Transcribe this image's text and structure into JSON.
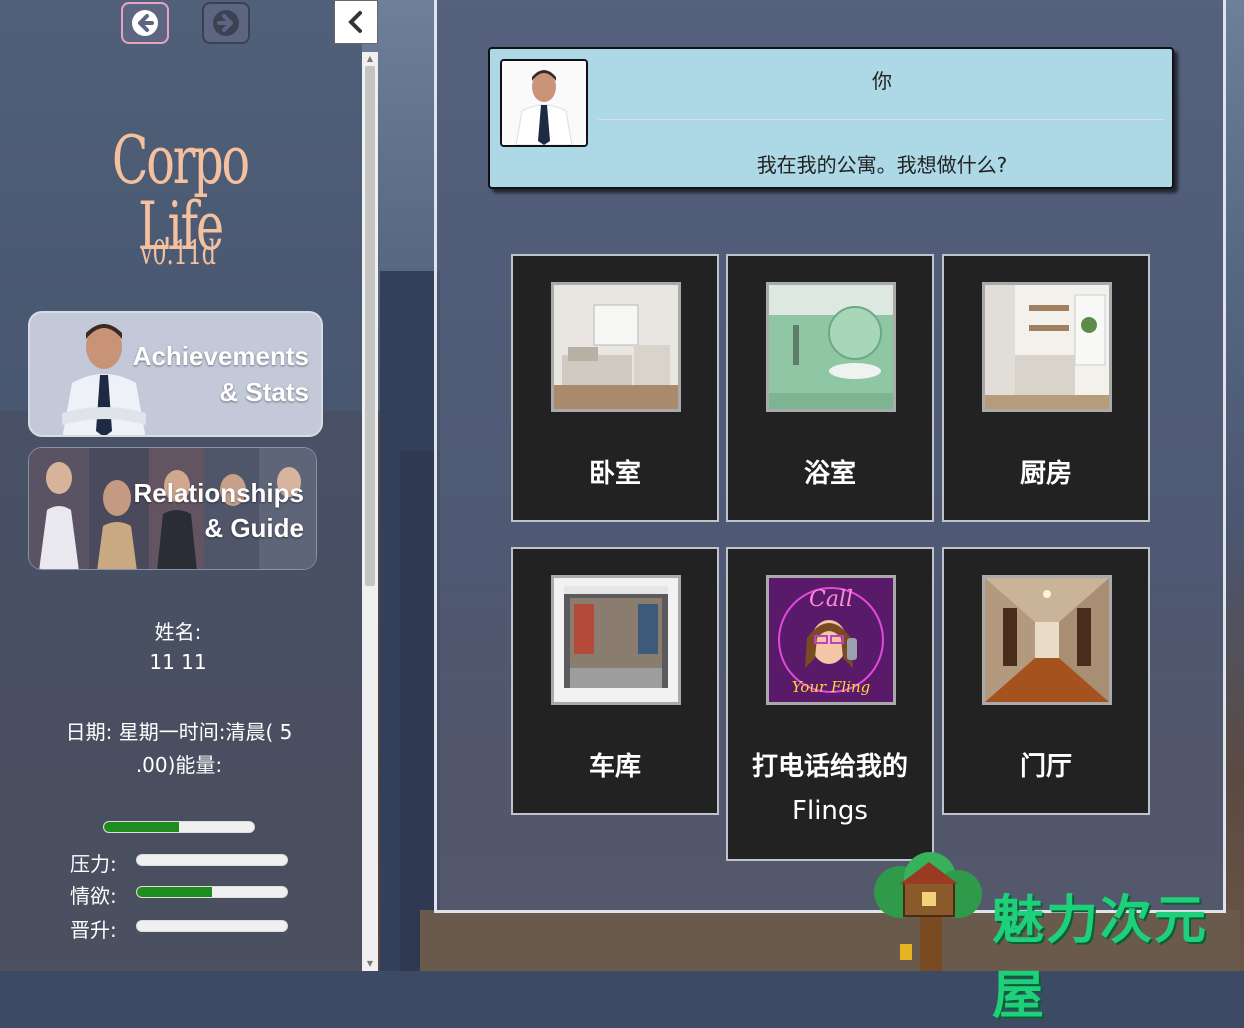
{
  "nav": {
    "back_icon": "arrow-left-icon",
    "forward_icon": "arrow-right-icon",
    "collapse_icon": "chevron-left-icon"
  },
  "sidebar": {
    "logo_title": "Corpo Life",
    "logo_version": "v0.11d",
    "achievements_line1": "Achievements",
    "achievements_line2": "& Stats",
    "relationships_line1": "Relationships",
    "relationships_line2": "& Guide",
    "name_label": "姓名:",
    "name_value": "11 11",
    "date_line1": "日期: 星期一时间:清晨( 5",
    "date_line2": ".00)能量:",
    "energy_level": 0.5,
    "stats": [
      {
        "label": "压力:",
        "level": 0.0
      },
      {
        "label": "情欲:",
        "level": 0.5
      },
      {
        "label": "晋升:",
        "level": 0.0
      }
    ]
  },
  "dialog": {
    "speaker": "你",
    "text": "我在我的公寓。我想做什么?"
  },
  "locations": [
    {
      "label": "卧室",
      "image": "bedroom"
    },
    {
      "label": "浴室",
      "image": "bathroom"
    },
    {
      "label": "厨房",
      "image": "kitchen"
    },
    {
      "label": "车库",
      "image": "garage"
    },
    {
      "label": "打电话给我的",
      "label2": "Flings",
      "image": "call-your-fling"
    },
    {
      "label": "门厅",
      "image": "hallway"
    }
  ],
  "call_image_text": {
    "top": "Call",
    "bottom": "Your Fling"
  },
  "watermark": {
    "text": "魅力次元屋"
  },
  "colors": {
    "accent_green": "#1f8c1f",
    "dialog_bg": "#add8e6",
    "logo": "#f5c09e",
    "watermark": "#1fd07a"
  }
}
